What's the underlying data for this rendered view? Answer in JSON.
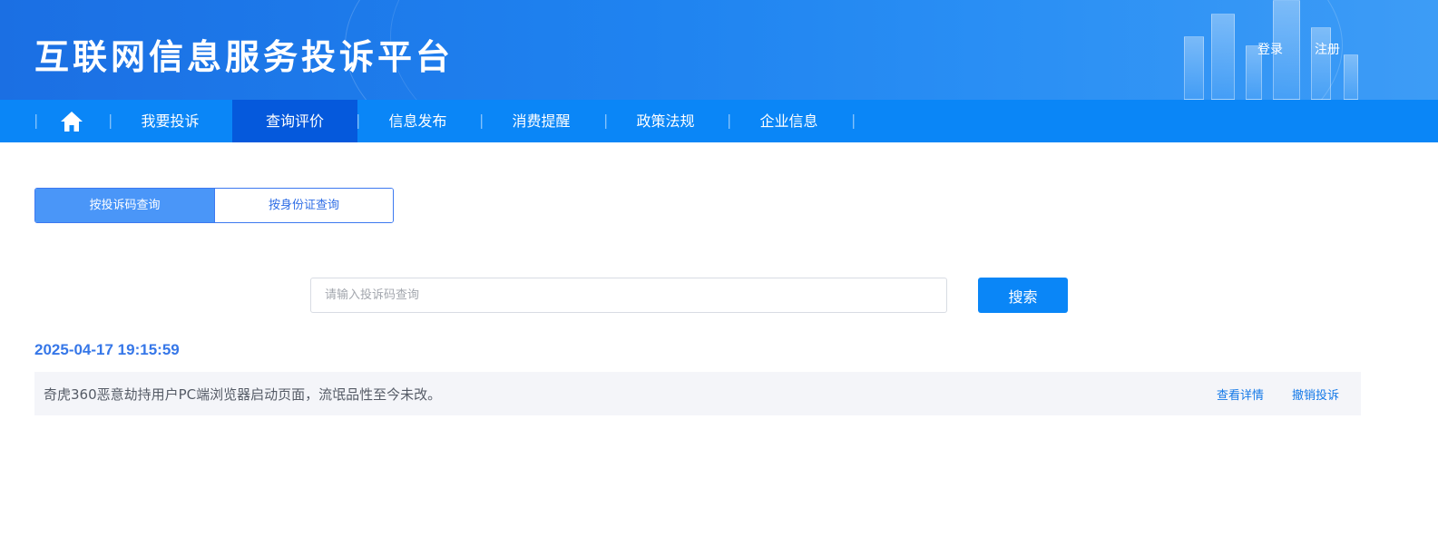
{
  "header": {
    "title": "互联网信息服务投诉平台",
    "login_label": "登录",
    "register_label": "注册"
  },
  "nav": {
    "home_icon": "home-icon",
    "items": [
      {
        "label": "我要投诉",
        "active": false
      },
      {
        "label": "查询评价",
        "active": true
      },
      {
        "label": "信息发布",
        "active": false
      },
      {
        "label": "消费提醒",
        "active": false
      },
      {
        "label": "政策法规",
        "active": false
      },
      {
        "label": "企业信息",
        "active": false
      }
    ],
    "separator": "|"
  },
  "query_tabs": [
    {
      "label": "按投诉码查询",
      "active": true
    },
    {
      "label": "按身份证查询",
      "active": false
    }
  ],
  "search": {
    "placeholder": "请输入投诉码查询",
    "value": "",
    "button_label": "搜索"
  },
  "records": [
    {
      "timestamp": "2025-04-17 19:15:59",
      "text": "奇虎360恶意劫持用户PC端浏览器启动页面，流氓品性至今未改。",
      "detail_label": "查看详情",
      "cancel_label": "撤销投诉"
    }
  ],
  "colors": {
    "brand": "#0a86f7",
    "nav_active": "#0559dc",
    "link": "#1479e8",
    "timestamp": "#3677e8"
  }
}
